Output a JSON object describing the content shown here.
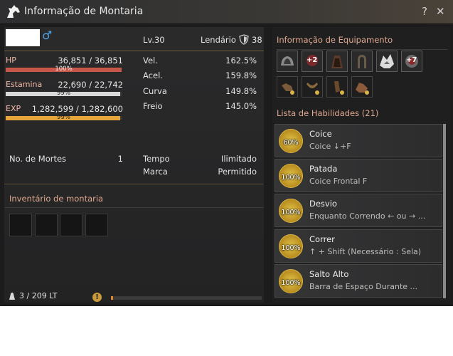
{
  "window": {
    "title": "Informação de Montaria",
    "help_label": "?",
    "close_label": "✕"
  },
  "mount": {
    "gender_symbol": "♂",
    "level": "Lv.30",
    "grade": "Lendário",
    "grade_value": "38",
    "stats": [
      {
        "label": "HP",
        "value": "36,851 / 36,851",
        "percent": "100%",
        "fraction": 1.0,
        "color": "#c8574a"
      },
      {
        "label": "Estamina",
        "value": "22,690 / 22,742",
        "percent": "99%",
        "fraction": 0.99,
        "color": "#d8d8d8"
      },
      {
        "label": "EXP",
        "value": "1,282,599 / 1,282,600",
        "percent": "99%",
        "fraction": 0.99,
        "color": "#e6a63a"
      }
    ],
    "speeds": [
      {
        "label": "Vel.",
        "value": "162.5%"
      },
      {
        "label": "Acel.",
        "value": "159.8%"
      },
      {
        "label": "Curva",
        "value": "149.8%"
      },
      {
        "label": "Freio",
        "value": "145.0%"
      }
    ],
    "kills_label": "No. de Mortes",
    "kills_value": "1",
    "time_label": "Tempo",
    "time_value": "Ilimitado",
    "mark_label": "Marca",
    "mark_value": "Permitido"
  },
  "inventory": {
    "title": "Inventário de montaria",
    "weight": "3 / 209 LT",
    "weight_fraction": 0.014
  },
  "equipment": {
    "title": "Informação de Equipamento",
    "row1": [
      {
        "icon": "saddle-icon",
        "badge": ""
      },
      {
        "icon": "stirrup-icon",
        "badge": "+2"
      },
      {
        "icon": "harness-icon",
        "badge": ""
      },
      {
        "icon": "horseshoe-icon",
        "badge": ""
      },
      {
        "icon": "barding-icon",
        "badge": ""
      },
      {
        "icon": "champron-icon",
        "badge": "+7"
      }
    ],
    "row2": [
      {
        "icon": "costume-saddle-icon"
      },
      {
        "icon": "costume-stirrup-icon"
      },
      {
        "icon": "costume-harness-icon"
      },
      {
        "icon": "costume-barding-icon"
      }
    ]
  },
  "skills": {
    "title": "Lista de Habilidades (21)",
    "items": [
      {
        "name": "Coice",
        "desc": "Coice ↓+F",
        "percent": "60%"
      },
      {
        "name": "Patada",
        "desc": "Coice Frontal F",
        "percent": "100%"
      },
      {
        "name": "Desvio",
        "desc": "Enquanto Correndo ← ou → ...",
        "percent": "100%"
      },
      {
        "name": "Correr",
        "desc": "↑ + Shift (Necessário : Sela)",
        "percent": "100%"
      },
      {
        "name": "Salto Alto",
        "desc": "Barra de Espaço Durante ...",
        "percent": "100%"
      }
    ]
  },
  "colors": {
    "accent_gold": "#e6a63a",
    "section_title": "#e0a990",
    "gender_blue": "#4fa3e6"
  }
}
